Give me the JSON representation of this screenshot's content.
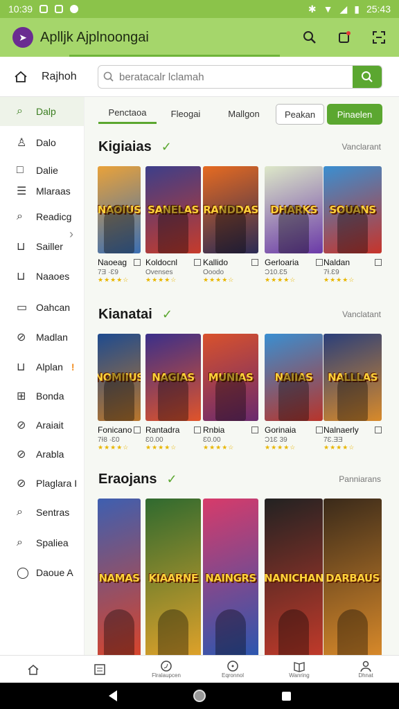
{
  "status": {
    "time": "10:39",
    "right": "25:43"
  },
  "app": {
    "title": "Aplljk Ajplnoongai"
  },
  "search": {
    "home_label": "Rajhoh",
    "placeholder": "beratacalr lclamah"
  },
  "sidebar": {
    "items": [
      {
        "label": "Dalp",
        "icon": "search-icon",
        "active": true
      },
      {
        "label": "Dalo",
        "icon": "person-icon"
      },
      {
        "label": "Dalie",
        "icon": "square-icon"
      },
      {
        "label": "Mlaraas",
        "icon": "list-icon"
      },
      {
        "label": "Readicg",
        "icon": "search-icon"
      },
      {
        "label": "Sailler",
        "icon": "cart-icon"
      },
      {
        "label": "Naaoes",
        "icon": "cart-icon"
      },
      {
        "label": "Oahcan",
        "icon": "box-icon"
      },
      {
        "label": "Madlan",
        "icon": "compass-icon"
      },
      {
        "label": "Alplan",
        "icon": "cart-icon",
        "badge": "!"
      },
      {
        "label": "Bonda",
        "icon": "grid-icon"
      },
      {
        "label": "Araiait",
        "icon": "compass-icon"
      },
      {
        "label": "Arabla",
        "icon": "compass-icon"
      },
      {
        "label": "Plaglara I",
        "icon": "compass-icon"
      },
      {
        "label": "Sentras",
        "icon": "search-icon"
      },
      {
        "label": "Spaliea",
        "icon": "search-icon"
      },
      {
        "label": "Daoue A",
        "icon": "circle-icon"
      }
    ]
  },
  "tabs": [
    "Penctaoa",
    "Fleogai",
    "Mallgon"
  ],
  "tab_buttons": {
    "outline": "Peakan",
    "filled": "Pinaelen"
  },
  "sections": [
    {
      "title": "Kigiaias",
      "more": "Vanclarant",
      "cards": [
        {
          "title": "Naoeag",
          "sub": "7Ǝ ·Ɛ9",
          "cover": "NAOIUS",
          "c1": "#e9a23a",
          "c2": "#3b6fb3"
        },
        {
          "title": "Koldocnl",
          "sub": "Ovenses",
          "cover": "SANELAS",
          "c1": "#3c3e8a",
          "c2": "#c63b2b"
        },
        {
          "title": "Kallido",
          "sub": "Ooodo",
          "cover": "RANDDAS",
          "c1": "#e66b21",
          "c2": "#2b2b55"
        },
        {
          "title": "Gerloaria",
          "sub": "Ɔ10.Ɛ5",
          "cover": "DHARKS",
          "c1": "#dde8c8",
          "c2": "#6b3aa8"
        },
        {
          "title": "Naldan",
          "sub": "7Ɨ.Ɛ9",
          "cover": "SOUANS",
          "c1": "#3a8fd1",
          "c2": "#c7342a"
        }
      ]
    },
    {
      "title": "Kianatai",
      "more": "Vanclatant",
      "cards": [
        {
          "title": "Fonicano",
          "sub": "7Ɨ8 ·Ɛ0",
          "cover": "NOMIIUS",
          "c1": "#1e4b8f",
          "c2": "#b9762c"
        },
        {
          "title": "Rantadra",
          "sub": "Ɛ0.00",
          "cover": "NAGIAS",
          "c1": "#3a2f8a",
          "c2": "#e0542a"
        },
        {
          "title": "Rnbia",
          "sub": "Ɛ0.00",
          "cover": "MUNIAS",
          "c1": "#d9522c",
          "c2": "#6a2a6e"
        },
        {
          "title": "Gorinaia",
          "sub": "Ɔ1Ɛ 39",
          "cover": "NAIIAS",
          "c1": "#3a8fd1",
          "c2": "#b8342a"
        },
        {
          "title": "Nalnaerly",
          "sub": "7Ɛ.ƎƎ",
          "cover": "NALLLAS",
          "c1": "#2a3f7a",
          "c2": "#d88a2a"
        }
      ]
    },
    {
      "title": "Eraojans",
      "more": "Panniarans",
      "cards": [
        {
          "title": "",
          "sub": "",
          "cover": "NAMAS",
          "c1": "#3e5fb0",
          "c2": "#d9442a"
        },
        {
          "title": "",
          "sub": "",
          "cover": "KIAARNE",
          "c1": "#2f6a2f",
          "c2": "#e0a22a"
        },
        {
          "title": "",
          "sub": "",
          "cover": "NAINGRS",
          "c1": "#d73b6a",
          "c2": "#2a57b0"
        },
        {
          "title": "",
          "sub": "",
          "cover": "NANICHAN",
          "c1": "#222222",
          "c2": "#c23a2a"
        },
        {
          "title": "",
          "sub": "",
          "cover": "DARBAUS",
          "c1": "#3a2a1a",
          "c2": "#d98a2a"
        }
      ]
    }
  ],
  "bottom_nav": [
    "",
    "",
    "Flralaupcen",
    "Eqronnol",
    "Wanring",
    "Dhnat"
  ],
  "colors": {
    "brand": "#8bc34a",
    "accent": "#5ba730"
  }
}
